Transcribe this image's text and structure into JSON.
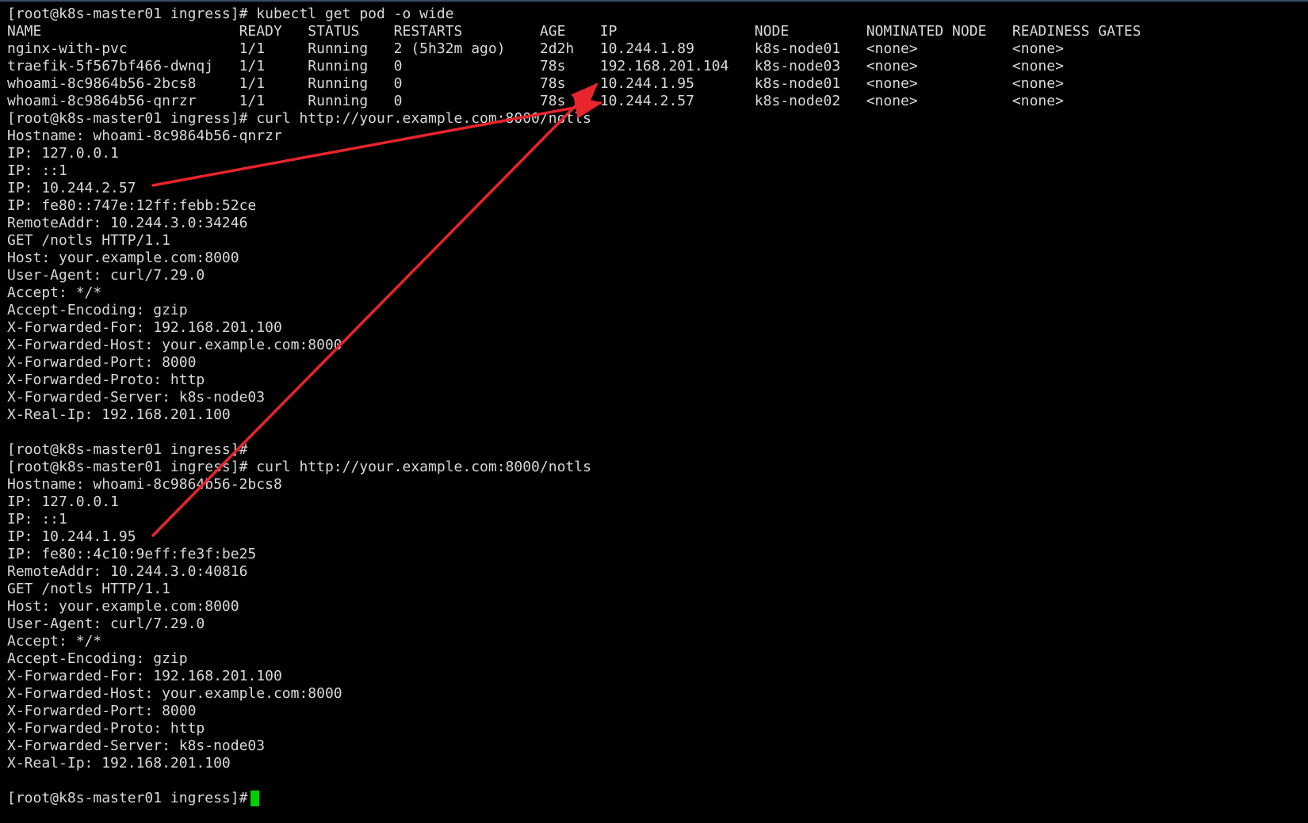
{
  "terminal": {
    "cursor_color": "#00d000",
    "text_color": "#d8d8d8",
    "background": "#000000",
    "lines": [
      "[root@k8s-master01 ingress]# kubectl get pod -o wide",
      "NAME                       READY   STATUS    RESTARTS         AGE    IP                NODE         NOMINATED NODE   READINESS GATES",
      "nginx-with-pvc             1/1     Running   2 (5h32m ago)    2d2h   10.244.1.89       k8s-node01   <none>           <none>",
      "traefik-5f567bf466-dwnqj   1/1     Running   0                78s    192.168.201.104   k8s-node03   <none>           <none>",
      "whoami-8c9864b56-2bcs8     1/1     Running   0                78s    10.244.1.95       k8s-node01   <none>           <none>",
      "whoami-8c9864b56-qnrzr     1/1     Running   0                78s    10.244.2.57       k8s-node02   <none>           <none>",
      "[root@k8s-master01 ingress]# curl http://your.example.com:8000/notls",
      "Hostname: whoami-8c9864b56-qnrzr",
      "IP: 127.0.0.1",
      "IP: ::1",
      "IP: 10.244.2.57",
      "IP: fe80::747e:12ff:febb:52ce",
      "RemoteAddr: 10.244.3.0:34246",
      "GET /notls HTTP/1.1",
      "Host: your.example.com:8000",
      "User-Agent: curl/7.29.0",
      "Accept: */*",
      "Accept-Encoding: gzip",
      "X-Forwarded-For: 192.168.201.100",
      "X-Forwarded-Host: your.example.com:8000",
      "X-Forwarded-Port: 8000",
      "X-Forwarded-Proto: http",
      "X-Forwarded-Server: k8s-node03",
      "X-Real-Ip: 192.168.201.100",
      "",
      "[root@k8s-master01 ingress]#",
      "[root@k8s-master01 ingress]# curl http://your.example.com:8000/notls",
      "Hostname: whoami-8c9864b56-2bcs8",
      "IP: 127.0.0.1",
      "IP: ::1",
      "IP: 10.244.1.95",
      "IP: fe80::4c10:9eff:fe3f:be25",
      "RemoteAddr: 10.244.3.0:40816",
      "GET /notls HTTP/1.1",
      "Host: your.example.com:8000",
      "User-Agent: curl/7.29.0",
      "Accept: */*",
      "Accept-Encoding: gzip",
      "X-Forwarded-For: 192.168.201.100",
      "X-Forwarded-Host: your.example.com:8000",
      "X-Forwarded-Port: 8000",
      "X-Forwarded-Proto: http",
      "X-Forwarded-Server: k8s-node03",
      "X-Real-Ip: 192.168.201.100",
      "",
      "[root@k8s-master01 ingress]#"
    ]
  },
  "annotations": {
    "arrow_color": "#e8242c"
  }
}
